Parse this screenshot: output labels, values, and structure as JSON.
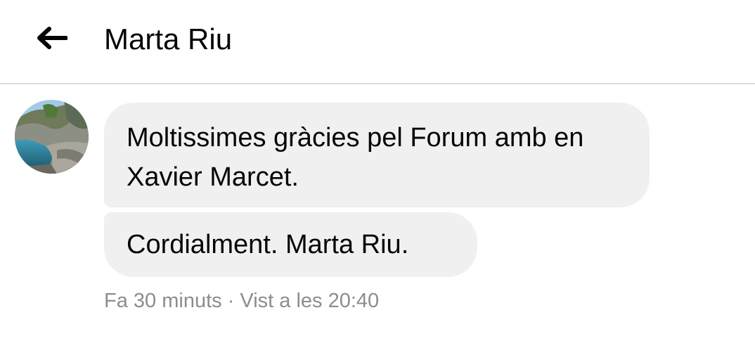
{
  "header": {
    "back_icon": "arrow-left-icon",
    "title": "Marta Riu"
  },
  "contact": {
    "avatar_icon": "profile-photo-landscape"
  },
  "messages": [
    {
      "text": "Moltissimes gràcies pel Forum amb en Xavier Marcet."
    },
    {
      "text": "Cordialment. Marta Riu."
    }
  ],
  "status": {
    "sent": "Fa 30 minuts",
    "separator": " · ",
    "seen": "Vist a les 20:40"
  },
  "colors": {
    "bubble_bg": "#f0f0f0",
    "divider": "#dadde1",
    "meta_text": "#8a8d91",
    "primary_text": "#050505"
  }
}
